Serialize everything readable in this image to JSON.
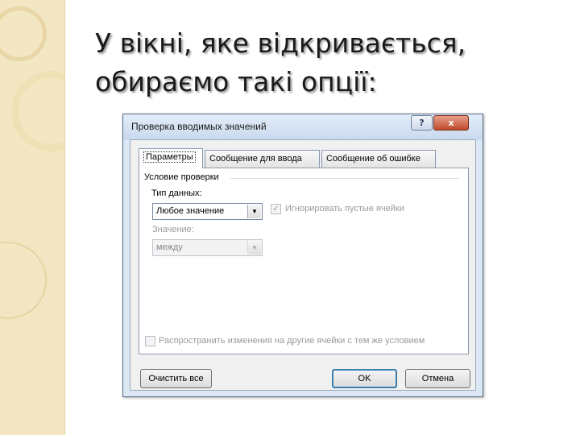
{
  "slide": {
    "title_line1": "У вікні, яке відкривається,",
    "title_line2": "обираємо такі опції:"
  },
  "dialog": {
    "title": "Проверка вводимых значений",
    "help_glyph": "?",
    "close_glyph": "x",
    "tabs": [
      {
        "label": "Параметры",
        "active": true
      },
      {
        "label": "Сообщение для ввода",
        "active": false
      },
      {
        "label": "Сообщение об ошибке",
        "active": false
      }
    ],
    "group_title": "Условие проверки",
    "data_type_label": "Тип данных:",
    "data_type_value": "Любое значение",
    "ignore_blank_label": "Игнорировать пустые ячейки",
    "ignore_blank_checked": true,
    "value_label": "Значение:",
    "value_value": "между",
    "apply_all_label": "Распространить изменения на другие ячейки с тем же условием",
    "apply_all_checked": false,
    "clear_all_label": "Очистить все",
    "ok_label": "OK",
    "cancel_label": "Отмена",
    "dropdown_arrow": "▼",
    "check_mark": "✓"
  },
  "colors": {
    "left_strip": "#f3e6c3",
    "dialog_frame": "#dbe7f4",
    "close_button": "#c24a2c",
    "default_button_border": "#3c7fb1"
  }
}
